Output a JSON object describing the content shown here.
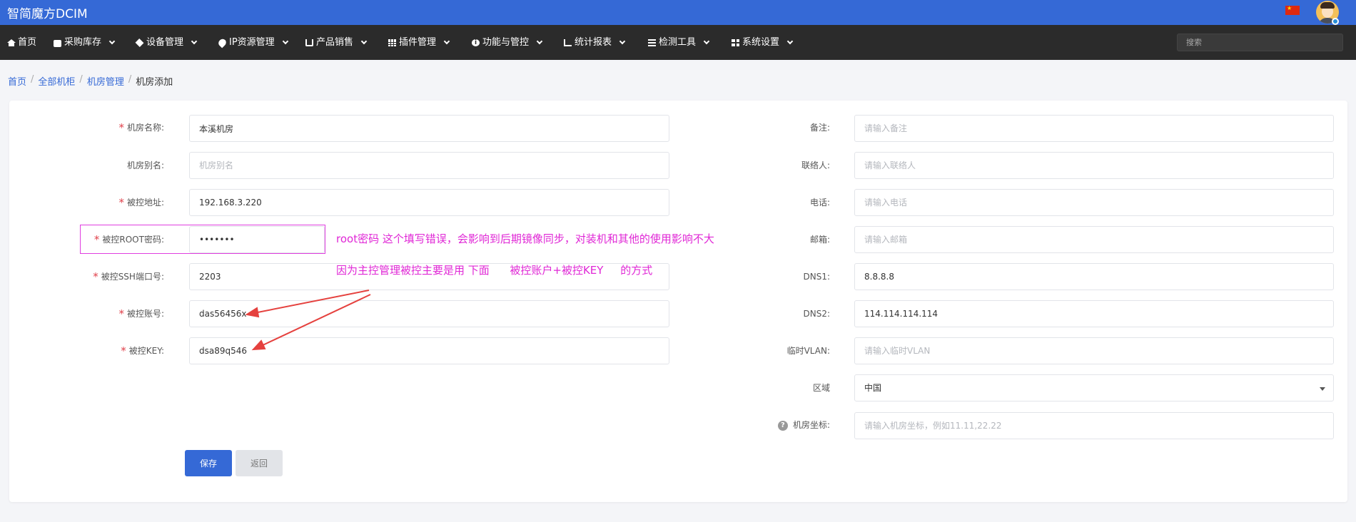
{
  "app": {
    "brand": "智简魔方DCIM"
  },
  "topbar": {
    "flag_icon": "china-flag-icon",
    "avatar_icon": "user-avatar-icon"
  },
  "nav": {
    "items": [
      {
        "label": "首页",
        "icon": "home-icon",
        "dropdown": false
      },
      {
        "label": "采购库存",
        "icon": "inbox-icon",
        "dropdown": true
      },
      {
        "label": "设备管理",
        "icon": "cube-icon",
        "dropdown": true
      },
      {
        "label": "IP资源管理",
        "icon": "map-marker-icon",
        "dropdown": true
      },
      {
        "label": "产品销售",
        "icon": "cart-icon",
        "dropdown": true
      },
      {
        "label": "插件管理",
        "icon": "table-icon",
        "dropdown": true
      },
      {
        "label": "功能与管控",
        "icon": "info-icon",
        "dropdown": true
      },
      {
        "label": "统计报表",
        "icon": "line-chart-icon",
        "dropdown": true
      },
      {
        "label": "检测工具",
        "icon": "list-icon",
        "dropdown": true
      },
      {
        "label": "系统设置",
        "icon": "th-large-icon",
        "dropdown": true
      }
    ],
    "search_placeholder": "搜索"
  },
  "breadcrumb": [
    {
      "label": "首页",
      "link": true
    },
    {
      "label": "全部机柜",
      "link": true
    },
    {
      "label": "机房管理",
      "link": true
    },
    {
      "label": "机房添加",
      "link": false
    }
  ],
  "form": {
    "left": [
      {
        "label": "机房名称:",
        "required": true,
        "value": "本溪机房",
        "placeholder": ""
      },
      {
        "label": "机房别名:",
        "required": false,
        "value": "",
        "placeholder": "机房别名"
      },
      {
        "label": "被控地址:",
        "required": true,
        "value": "192.168.3.220",
        "placeholder": ""
      },
      {
        "label": "被控ROOT密码:",
        "required": true,
        "value": "•••••••",
        "placeholder": ""
      },
      {
        "label": "被控SSH端口号:",
        "required": true,
        "value": "2203",
        "placeholder": ""
      },
      {
        "label": "被控账号:",
        "required": true,
        "value": "das56456x",
        "placeholder": ""
      },
      {
        "label": "被控KEY:",
        "required": true,
        "value": "dsa89q546",
        "placeholder": ""
      }
    ],
    "right": [
      {
        "label": "备注:",
        "value": "",
        "placeholder": "请输入备注"
      },
      {
        "label": "联络人:",
        "value": "",
        "placeholder": "请输入联络人"
      },
      {
        "label": "电话:",
        "value": "",
        "placeholder": "请输入电话"
      },
      {
        "label": "邮箱:",
        "value": "",
        "placeholder": "请输入邮箱"
      },
      {
        "label": "DNS1:",
        "value": "8.8.8.8",
        "placeholder": ""
      },
      {
        "label": "DNS2:",
        "value": "114.114.114.114",
        "placeholder": ""
      },
      {
        "label": "临时VLAN:",
        "value": "",
        "placeholder": "请输入临时VLAN"
      },
      {
        "label": "区域",
        "value": "中国",
        "placeholder": ""
      },
      {
        "label": "机房坐标:",
        "value": "",
        "placeholder": "请输入机房坐标，例如11.11,22.22"
      }
    ],
    "save_label": "保存",
    "back_label": "返回"
  },
  "annotations": {
    "line1": "root密码 这个填写错误，会影响到后期镜像同步，对装机和其他的使用影响不大",
    "line2": "因为主控管理被控主要是用 下面      被控账户+被控KEY     的方式",
    "color": "#e027d6"
  }
}
